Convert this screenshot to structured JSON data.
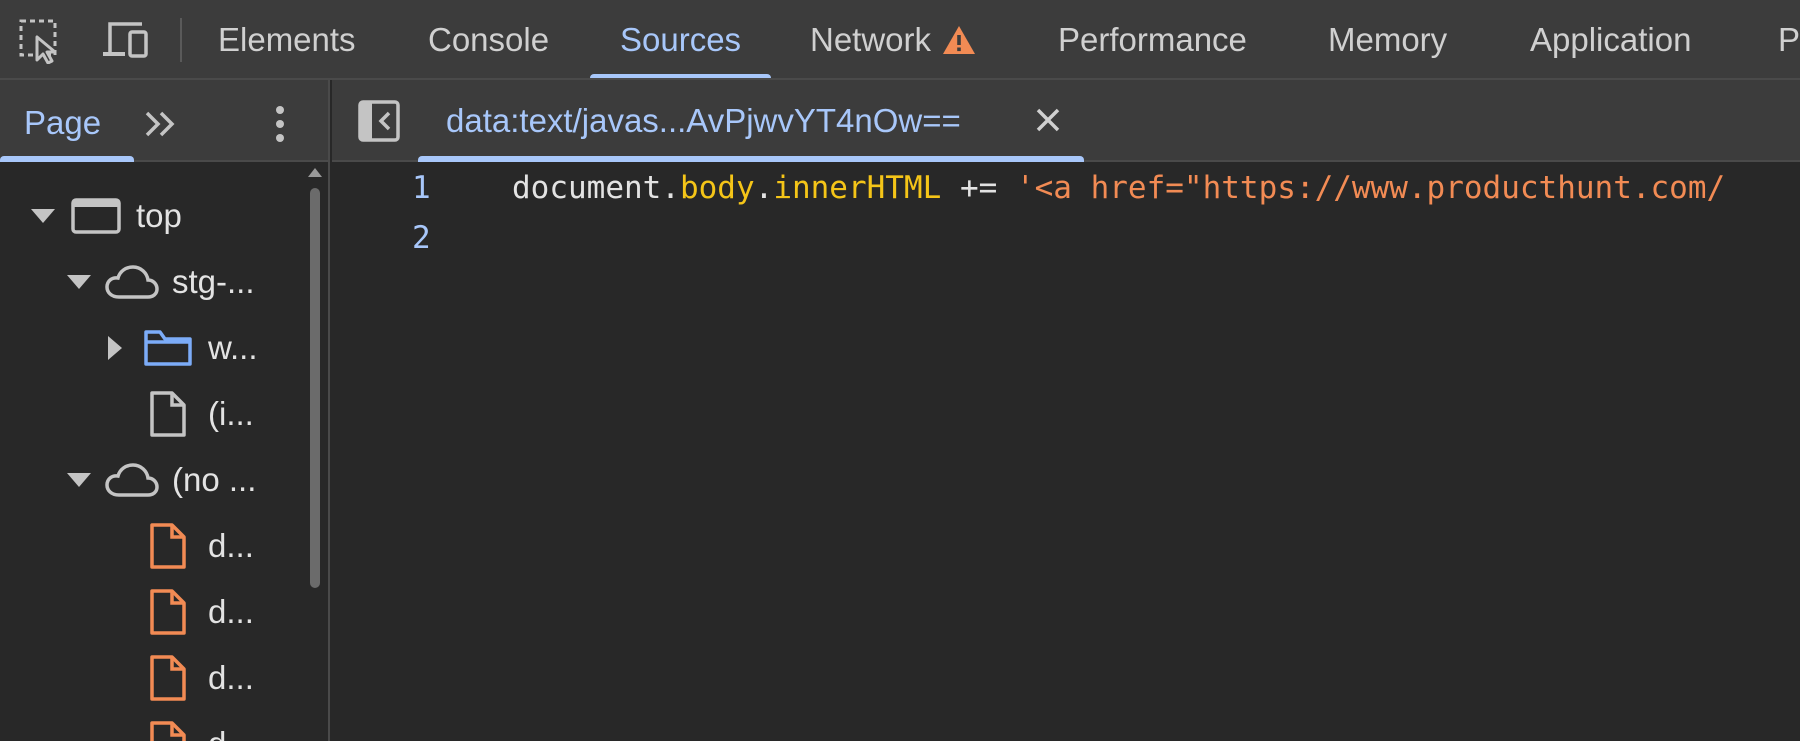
{
  "toolbar": {
    "icons": [
      "inspect-element-icon",
      "device-toolbar-icon"
    ],
    "tabs": [
      {
        "label": "Elements"
      },
      {
        "label": "Console"
      },
      {
        "label": "Sources"
      },
      {
        "label": "Network"
      },
      {
        "label": "Performance"
      },
      {
        "label": "Memory"
      },
      {
        "label": "Application"
      },
      {
        "label": "P"
      }
    ],
    "active_tab": "Sources",
    "network_warning_icon": "warning-triangle-icon",
    "accent_color": "#a8c7fa",
    "warning_color": "#f28b54"
  },
  "navigator": {
    "tab_label": "Page",
    "more_tabs_icon": "double-chevron-right-icon",
    "menu_icon": "kebab-menu-icon",
    "tree": [
      {
        "label": "top",
        "icon": "frame-icon",
        "expanded": true
      },
      {
        "label": "stg-...",
        "icon": "cloud-icon",
        "expanded": true
      },
      {
        "label": "w...",
        "icon": "folder-icon",
        "expanded": false
      },
      {
        "label": "(i...",
        "icon": "file-icon"
      },
      {
        "label": "(no ...",
        "icon": "cloud-icon",
        "expanded": true
      },
      {
        "label": "d...",
        "icon": "script-file-icon"
      },
      {
        "label": "d...",
        "icon": "script-file-icon"
      },
      {
        "label": "d...",
        "icon": "script-file-icon"
      },
      {
        "label": "d...",
        "icon": "script-file-icon"
      }
    ]
  },
  "editor": {
    "toggle_icon": "toggle-navigator-icon",
    "open_file": {
      "label": "data:text/javas...AvPjwvYT4nOw==",
      "close_icon": "close-icon"
    },
    "lines": [
      {
        "number": "1",
        "tokens": [
          {
            "text": "document.",
            "kind": "plain"
          },
          {
            "text": "body",
            "kind": "prop"
          },
          {
            "text": ".",
            "kind": "plain"
          },
          {
            "text": "innerHTML",
            "kind": "prop"
          },
          {
            "text": " += ",
            "kind": "plain"
          },
          {
            "text": "'<a href=\"https://www.producthunt.com/",
            "kind": "str"
          }
        ]
      },
      {
        "number": "2",
        "tokens": []
      }
    ]
  }
}
